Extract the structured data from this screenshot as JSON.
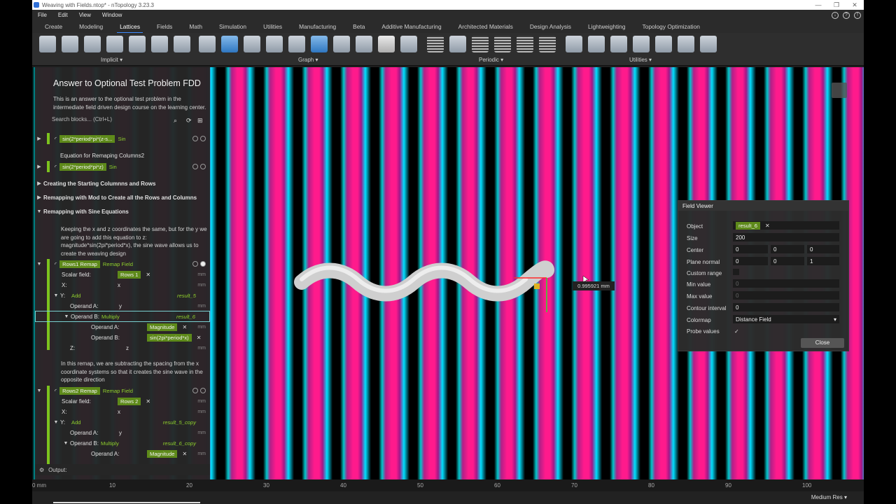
{
  "titlebar": {
    "title": "Weaving with Fields.ntop* - nTopology 3.23.3"
  },
  "menu": [
    "File",
    "Edit",
    "View",
    "Window"
  ],
  "tabs": [
    "Create",
    "Modeling",
    "Lattices",
    "Fields",
    "Math",
    "Simulation",
    "Utilities",
    "Manufacturing",
    "Beta",
    "Additive Manufacturing",
    "Architected Materials",
    "Design Analysis",
    "Lightweighting",
    "Topology Optimization"
  ],
  "active_tab": "Lattices",
  "toolbar_groups": [
    "Implicit",
    "Graph",
    "Periodic",
    "Utilities"
  ],
  "panel": {
    "title": "Answer to Optional Test Problem FDD",
    "description": "This is an answer to the optional test problem in the intermediate field driven design course on the learning center.",
    "search_placeholder": "Search blocks... (Ctrl+L)",
    "rows": {
      "sin_block_1": "sin(2*period*pi*(z-s...",
      "sin_block_1_type": "Sin",
      "equation_label": "Equation for Remaping Columns2",
      "sin_block_2": "sin(2*period*pi*z)",
      "sin_block_2_type": "Sin",
      "section_1": "Creating the Starting Columnns and Rows",
      "section_2": "Remapping with Mod to Create all the Rows and Columns",
      "section_3": "Remapping with Sine Equations",
      "note_1": "Keeping the x and z coordinates the same, but for the y we are going to add this equation to z: magnitude*sin(2pi*period*x), the sine wave allows us to create the weaving design",
      "rows1_name": "Rows1 Remap",
      "rows1_type": "Remap Field",
      "scalar_label": "Scalar field:",
      "rows1_scalar": "Rows 1",
      "x_label": "X:",
      "x_value": "x",
      "y_label": "Y:",
      "y_type": "Add",
      "y_result": "result_5",
      "opA_label": "Operand A:",
      "opA_value": "y",
      "opB_label": "Operand B:",
      "opB_type": "Multiply",
      "opB_result": "result_6",
      "magnitude": "Magnitude",
      "sin_expr": "sin(2pi*period*x)",
      "z_label": "Z:",
      "z_value": "z",
      "note_2": "In this remap, we are subtracting the spacing from the x coordinate systems so that it creates the sine wave in the opposite direction",
      "rows2_name": "Rows2 Remap",
      "rows2_type": "Remap Field",
      "rows2_scalar": "Rows 2",
      "y2_result": "result_5_copy",
      "opB2_result": "result_6_copy",
      "units": "mm"
    },
    "output_label": "Output:"
  },
  "field_viewer": {
    "title": "Field Viewer",
    "labels": [
      "Object",
      "Size",
      "Center",
      "Plane normal",
      "Custom range",
      "Min value",
      "Max value",
      "Contour interval",
      "Colormap",
      "Probe values"
    ],
    "object": "result_6",
    "size": "200",
    "center": [
      "0",
      "0",
      "0"
    ],
    "plane_normal": [
      "0",
      "0",
      "1"
    ],
    "min_value": "0",
    "max_value": "0",
    "contour_interval": "0",
    "colormap": "Distance Field",
    "probe_check": "✓",
    "close": "Close"
  },
  "probe_readout": "0.995921 mm",
  "ruler": [
    "0 mm",
    "10",
    "20",
    "30",
    "40",
    "50",
    "60",
    "70",
    "80",
    "90",
    "100"
  ],
  "status": {
    "resolution": "Medium Res"
  }
}
